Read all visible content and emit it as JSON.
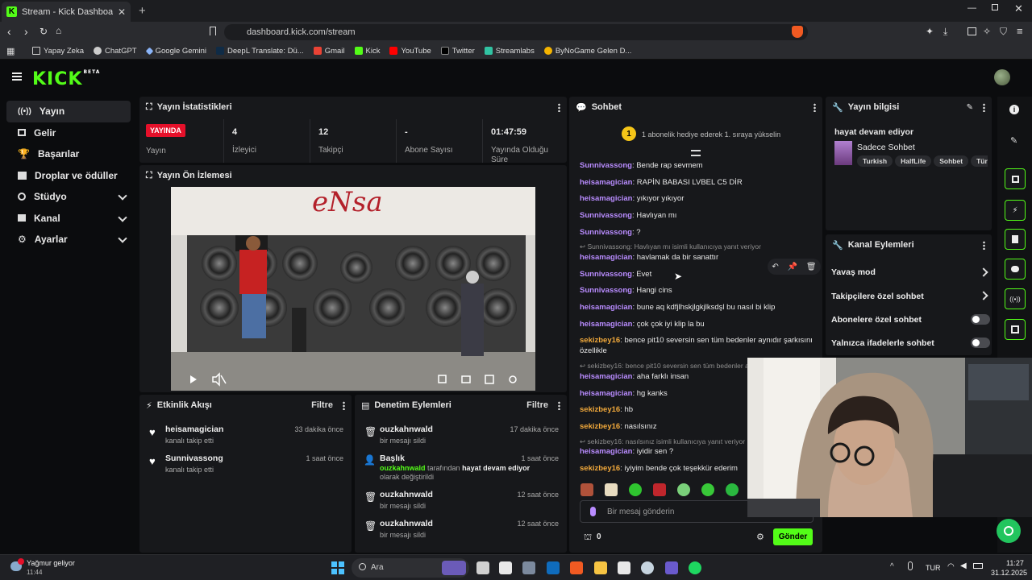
{
  "browser": {
    "tab_title": "Stream - Kick Dashboard",
    "url": "dashboard.kick.com/stream",
    "bookmarks": [
      "Yapay Zeka",
      "ChatGPT",
      "Google Gemini",
      "DeepL Translate: Dü...",
      "Gmail",
      "Kick",
      "YouTube",
      "Twitter",
      "Streamlabs",
      "ByNoGame Gelen D..."
    ]
  },
  "app": {
    "logo": "KICK",
    "logo_badge": "BETA"
  },
  "sidebar": {
    "items": [
      {
        "label": "Yayın",
        "icon": "broadcast-icon",
        "active": true
      },
      {
        "label": "Gelir",
        "icon": "revenue-icon"
      },
      {
        "label": "Başarılar",
        "icon": "trophy-icon"
      },
      {
        "label": "Droplar ve ödüller",
        "icon": "gift-icon"
      },
      {
        "label": "Stüdyo",
        "icon": "studio-icon"
      },
      {
        "label": "Kanal",
        "icon": "channel-icon"
      },
      {
        "label": "Ayarlar",
        "icon": "gear-icon"
      }
    ]
  },
  "stats": {
    "title": "Yayın İstatistikleri",
    "live_badge": "YAYINDA",
    "live_label": "Yayın",
    "viewers": {
      "value": "4",
      "label": "İzleyici"
    },
    "followers": {
      "value": "12",
      "label": "Takipçi"
    },
    "subs": {
      "value": "-",
      "label": "Abone Sayısı"
    },
    "uptime": {
      "value": "01:47:59",
      "label": "Yayında Olduğu Süre"
    }
  },
  "preview": {
    "title": "Yayın Ön İzlemesi"
  },
  "activity": {
    "title": "Etkinlik Akışı",
    "filter": "Filtre",
    "items": [
      {
        "name": "heisamagician",
        "sub": "kanalı takip etti",
        "time": "33 dakika önce"
      },
      {
        "name": "Sunnivassong",
        "sub": "kanalı takip etti",
        "time": "1 saat önce"
      }
    ]
  },
  "moderation": {
    "title": "Denetim Eylemleri",
    "filter": "Filtre",
    "items": [
      {
        "name": "ouzkahnwald",
        "sub": "bir mesajı sildi",
        "time": "17 dakika önce"
      },
      {
        "name": "Başlık",
        "sub_user": "ouzkahnwald",
        "sub_mid": " tarafından ",
        "sub_title": "hayat devam ediyor",
        "sub_end": " olarak değiştirildi",
        "time": "1 saat önce"
      },
      {
        "name": "ouzkahnwald",
        "sub": "bir mesajı sildi",
        "time": "12 saat önce"
      },
      {
        "name": "ouzkahnwald",
        "sub": "bir mesajı sildi",
        "time": "12 saat önce"
      }
    ]
  },
  "chat": {
    "title": "Sohbet",
    "gift_rank": "1",
    "gift_text": "1 abonelik hediye ederek 1. sıraya yükselin",
    "messages": [
      {
        "user": "Sunnivassong",
        "text": "Bende rap sevmem"
      },
      {
        "user": "heisamagician",
        "text": "RAPİN BABASI LVBEL C5 DİR"
      },
      {
        "user": "heisamagician",
        "text": "yıkıyor yıkıyor"
      },
      {
        "user": "Sunnivassong",
        "text": "Havlıyan mı"
      },
      {
        "user": "Sunnivassong",
        "text": "?"
      },
      {
        "reply": "Sunnivassong: Havlıyan mı isimli kullanıcıya yanıt veriyor",
        "user": "heisamagician",
        "text": "havlamak da bir sanattır"
      },
      {
        "user": "Sunnivassong",
        "text": "Evet"
      },
      {
        "user": "Sunnivassong",
        "text": "Hangi cins"
      },
      {
        "user": "heisamagician",
        "text": "bune aq kdfjlhskjlgkjlksdşl bu nasıl bi klip"
      },
      {
        "user": "heisamagician",
        "text": "çok çok iyi klip la bu"
      },
      {
        "user": "sekizbey16",
        "text": "bence pit10 seversin sen tüm bedenler aynıdır şarkısını özellikle"
      },
      {
        "reply": "sekizbey16: bence pit10 seversin sen tüm bedenler a",
        "user": "heisamagician",
        "text": "aha farklı insan"
      },
      {
        "user": "heisamagician",
        "text": "hg kanks"
      },
      {
        "user": "sekizbey16",
        "text": "hb"
      },
      {
        "user": "sekizbey16",
        "text": "nasılsınız"
      },
      {
        "reply": "sekizbey16: nasılsınız isimli kullanıcıya yanıt veriyor",
        "user": "heisamagician",
        "text": "iyidir sen ?"
      },
      {
        "user": "sekizbey16",
        "text": "iyiyim bende çok teşekkür ederim"
      }
    ],
    "input_placeholder": "Bir mesaj gönderin",
    "points": "0",
    "send": "Gönder"
  },
  "stream_info": {
    "title": "Yayın bilgisi",
    "stream_title": "hayat devam ediyor",
    "category": "Sadece Sohbet",
    "tags": [
      "Turkish",
      "HalfLife",
      "Sohbet",
      "Türkç"
    ]
  },
  "channel_actions": {
    "title": "Kanal Eylemleri",
    "items": [
      {
        "label": "Yavaş mod",
        "kind": "chevron"
      },
      {
        "label": "Takipçilere özel sohbet",
        "kind": "chevron"
      },
      {
        "label": "Abonelere özel sohbet",
        "kind": "toggle",
        "on": false
      },
      {
        "label": "Yalnızca ifadelerle sohbet",
        "kind": "toggle",
        "on": false
      }
    ]
  },
  "taskbar": {
    "weather": "Yağmur geliyor",
    "weather_time": "11:44",
    "search": "Ara",
    "lang": "TUR",
    "time": "11:27",
    "date": "31.12.2025"
  },
  "colors": {
    "accent": "#53fc18",
    "live": "#e5102a",
    "purple_user": "#b98cff",
    "orange_user": "#f2a93b"
  }
}
